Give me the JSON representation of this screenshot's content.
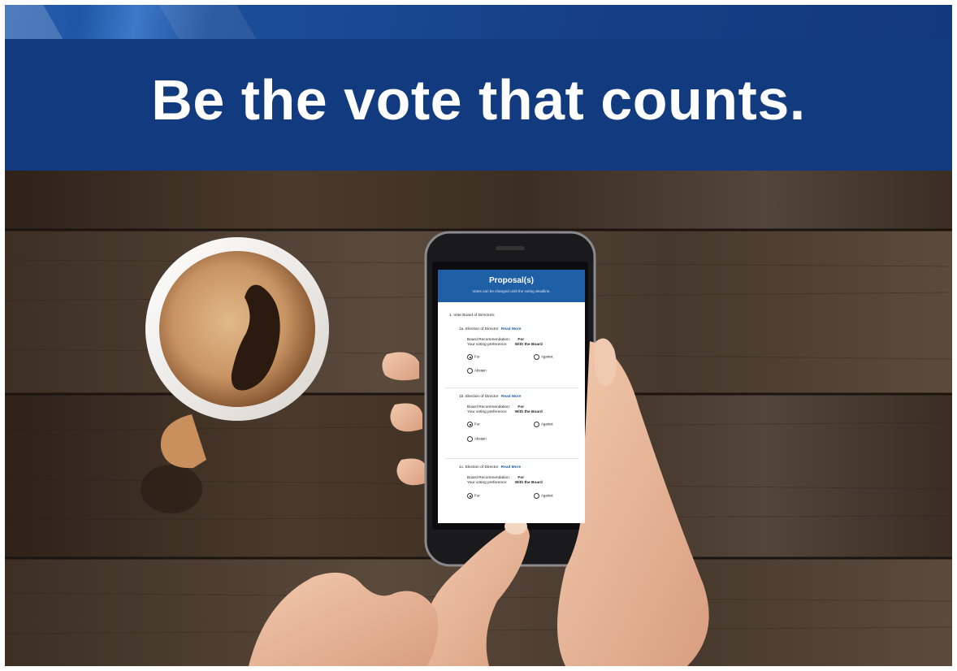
{
  "banner": {
    "headline": "Be the vote that counts."
  },
  "phone": {
    "screen": {
      "title": "Proposal(s)",
      "subtitle": "Votes can be changed until the voting deadline.",
      "section_title": "1. Vote Board of Directors:",
      "items": [
        {
          "title": "1a. Election of Director",
          "read_more": "Read More",
          "recommendation_label": "Board Recommendation:",
          "recommendation_value": "For",
          "preference_label": "Your voting preference:",
          "preference_value": "With the Board",
          "options": [
            "For",
            "Against",
            "Abstain"
          ],
          "selected": "For"
        },
        {
          "title": "1b. Election of Director",
          "read_more": "Read More",
          "recommendation_label": "Board Recommendation:",
          "recommendation_value": "For",
          "preference_label": "Your voting preference:",
          "preference_value": "With the Board",
          "options": [
            "For",
            "Against",
            "Abstain"
          ],
          "selected": "For"
        },
        {
          "title": "1c. Election of Director",
          "read_more": "Read More",
          "recommendation_label": "Board Recommendation:",
          "recommendation_value": "For",
          "preference_label": "Your voting preference:",
          "preference_value": "With the Board",
          "options": [
            "For",
            "Against"
          ],
          "selected": "For"
        }
      ]
    }
  },
  "colors": {
    "banner_blue": "#123a7e",
    "screen_header_blue": "#1f5fa6",
    "wood": "#3a2d22"
  }
}
